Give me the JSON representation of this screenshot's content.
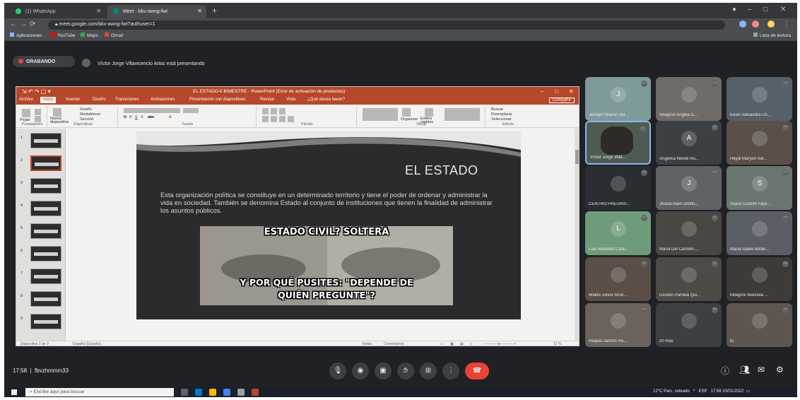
{
  "browser": {
    "tabs": [
      {
        "label": "(1) WhatsApp"
      },
      {
        "label": "Meet - bkv-awng-fwt"
      }
    ],
    "url": "meet.google.com/bkv-awng-fwt?authuser=1",
    "bookmarks": [
      "Aplicaciones",
      "YouTube",
      "Maps",
      "Gmail"
    ],
    "reading_list": "Lista de lectura"
  },
  "meet": {
    "recording_label": "GRABANDO",
    "presenting_text": "Víctor Jorge Villavicencio Arias está presentando",
    "time": "17:58",
    "meeting_code": "fbvzhmmm33",
    "controls": [
      "mic",
      "camera",
      "captions",
      "raise-hand",
      "present",
      "more",
      "hang-up"
    ]
  },
  "powerpoint": {
    "qat": "⇲ ↶ ↷ ▢ ▾",
    "title": "EL ESTADO-II BIMESTRE - PowerPoint (Error de activación de productos)",
    "share": "Compartir",
    "tabs": [
      "Archivo",
      "Inicio",
      "Insertar",
      "Diseño",
      "Transiciones",
      "Animaciones",
      "Presentación con diapositivas",
      "Revisar",
      "Vista",
      "¿Qué desea hacer?"
    ],
    "ribbon_groups": [
      "Portapapeles",
      "Diapositivas",
      "Fuente",
      "Párrafo",
      "Dibujo",
      "Edición"
    ],
    "ribbon_buttons": {
      "paste": "Pegar",
      "new_slide": "Nueva diapositiva",
      "design": "Diseño",
      "reset": "Restablecer",
      "section": "Sección",
      "arrange": "Organizar",
      "quick_styles": "Estilos rápidos",
      "find": "Buscar",
      "replace": "Reemplazar",
      "select": "Seleccionar"
    },
    "slide_numbers": [
      "1",
      "2",
      "3",
      "4",
      "5",
      "6",
      "7",
      "8",
      "9"
    ],
    "status_left": "Diapositiva 2 de 9",
    "status_lang": "Español (España)",
    "status_notes": "Notas",
    "status_comments": "Comentarios",
    "zoom": "72 %"
  },
  "slide": {
    "title": "EL ESTADO",
    "body": "Esta organización política se constituye en un determinado territorio y tiene el poder de ordenar y administrar la vida en sociedad. También se denomina Estado al conjunto de instituciones que tienen la finalidad de administrar los asuntos públicos.",
    "meme_top": "ESTADO CIVIL?  SOLTERA",
    "meme_bottom_1": "Y POR QUÉ PUSITES: \"DEPENDE DE",
    "meme_bottom_2": "QUIÉN PREGUNTE\"?"
  },
  "participants": [
    {
      "name": "Jocelyn Sharon Ant...",
      "initial": "J",
      "color": "#7e9b9a"
    },
    {
      "name": "Milagros Angela G...",
      "initial": "",
      "color": "#6f6b66"
    },
    {
      "name": "Kevin Alexandra Ch...",
      "initial": "",
      "color": "#56606a"
    },
    {
      "name": "Víctor Jorge Villa...",
      "initial": "",
      "color": "#4e5b52"
    },
    {
      "name": "Angelica Nikole Ro...",
      "initial": "A",
      "color": "#3c4043"
    },
    {
      "name": "Heydi Maryori Var...",
      "initial": "",
      "color": "#5a5048"
    },
    {
      "name": "CENTRO PREURIV...",
      "initial": "",
      "color": "#2a2d31"
    },
    {
      "name": "Jhosia Alain Ordóñ...",
      "initial": "J",
      "color": "#5f6368"
    },
    {
      "name": "Sayuri Lisseth Faye...",
      "initial": "S",
      "color": "#6b7670"
    },
    {
      "name": "Luis Reinaldo Cata...",
      "initial": "L",
      "color": "#6e9c7a"
    },
    {
      "name": "María Del Carmen ...",
      "initial": "",
      "color": "#4a4642"
    },
    {
      "name": "María Isabel Adran...",
      "initial": "",
      "color": "#5a5f66"
    },
    {
      "name": "Waldo Junior Anoc...",
      "initial": "",
      "color": "#5a4e46"
    },
    {
      "name": "Dioslen Pamela Qui...",
      "initial": "",
      "color": "#4f4a45"
    },
    {
      "name": "Milagros Maricela ...",
      "initial": "",
      "color": "#3e3a37"
    },
    {
      "name": "Raquel Jazmín Ro...",
      "initial": "",
      "color": "#6a625c"
    },
    {
      "name": "20 más",
      "initial": "",
      "color": "#3c4043"
    },
    {
      "name": "tú",
      "initial": "",
      "color": "#5d5650"
    }
  ],
  "taskbar": {
    "search_placeholder": "Escribe aquí para buscar",
    "weather": "12°C Parc. soleado",
    "lang": "ESP",
    "time": "17:58",
    "date": "10/01/2022"
  },
  "colors": {
    "ppt_accent": "#b7472a",
    "meet_bg": "#202124",
    "hangup": "#ea4335"
  }
}
